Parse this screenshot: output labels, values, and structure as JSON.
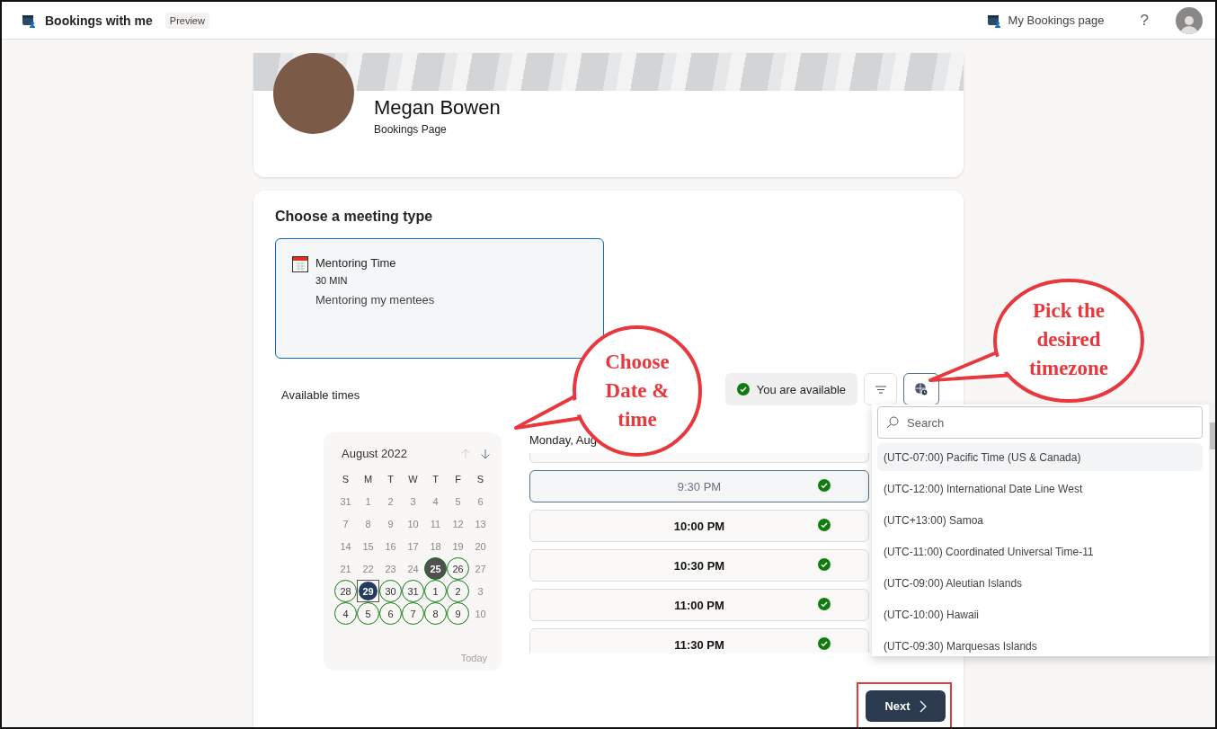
{
  "app": {
    "title": "Bookings with me",
    "badge": "Preview",
    "link": "My Bookings page",
    "help": "?"
  },
  "profile": {
    "name": "Megan Bowen",
    "subtitle": "Bookings Page"
  },
  "meeting_types": {
    "heading": "Choose a meeting type",
    "items": [
      {
        "name": "Mentoring Time",
        "duration": "30 MIN",
        "description": "Mentoring my mentees",
        "selected": true
      }
    ]
  },
  "availability": {
    "heading": "Available times",
    "status": "You are available",
    "available": true
  },
  "calendar": {
    "month": "August 2022",
    "previous_disabled": true,
    "next_disabled": false,
    "weekdays": [
      "S",
      "M",
      "T",
      "W",
      "T",
      "F",
      "S"
    ],
    "today_link": "Today",
    "weeks": [
      [
        {
          "label": "31",
          "available": false,
          "selected": false,
          "today": false
        },
        {
          "label": "1",
          "available": false,
          "selected": false,
          "today": false
        },
        {
          "label": "2",
          "available": false,
          "selected": false,
          "today": false
        },
        {
          "label": "3",
          "available": false,
          "selected": false,
          "today": false
        },
        {
          "label": "4",
          "available": false,
          "selected": false,
          "today": false
        },
        {
          "label": "5",
          "available": false,
          "selected": false,
          "today": false
        },
        {
          "label": "6",
          "available": false,
          "selected": false,
          "today": false
        }
      ],
      [
        {
          "label": "7",
          "available": false,
          "selected": false,
          "today": false
        },
        {
          "label": "8",
          "available": false,
          "selected": false,
          "today": false
        },
        {
          "label": "9",
          "available": false,
          "selected": false,
          "today": false
        },
        {
          "label": "10",
          "available": false,
          "selected": false,
          "today": false
        },
        {
          "label": "11",
          "available": false,
          "selected": false,
          "today": false
        },
        {
          "label": "12",
          "available": false,
          "selected": false,
          "today": false
        },
        {
          "label": "13",
          "available": false,
          "selected": false,
          "today": false
        }
      ],
      [
        {
          "label": "14",
          "available": false,
          "selected": false,
          "today": false
        },
        {
          "label": "15",
          "available": false,
          "selected": false,
          "today": false
        },
        {
          "label": "16",
          "available": false,
          "selected": false,
          "today": false
        },
        {
          "label": "17",
          "available": false,
          "selected": false,
          "today": false
        },
        {
          "label": "18",
          "available": false,
          "selected": false,
          "today": false
        },
        {
          "label": "19",
          "available": false,
          "selected": false,
          "today": false
        },
        {
          "label": "20",
          "available": false,
          "selected": false,
          "today": false
        }
      ],
      [
        {
          "label": "21",
          "available": false,
          "selected": false,
          "today": false
        },
        {
          "label": "22",
          "available": false,
          "selected": false,
          "today": false
        },
        {
          "label": "23",
          "available": false,
          "selected": false,
          "today": false
        },
        {
          "label": "24",
          "available": false,
          "selected": false,
          "today": false
        },
        {
          "label": "25",
          "available": true,
          "selected": false,
          "today": true
        },
        {
          "label": "26",
          "available": true,
          "selected": false,
          "today": false
        },
        {
          "label": "27",
          "available": false,
          "selected": false,
          "today": false
        }
      ],
      [
        {
          "label": "28",
          "available": true,
          "selected": false,
          "today": false
        },
        {
          "label": "29",
          "available": true,
          "selected": true,
          "today": false
        },
        {
          "label": "30",
          "available": true,
          "selected": false,
          "today": false
        },
        {
          "label": "31",
          "available": true,
          "selected": false,
          "today": false
        },
        {
          "label": "1",
          "available": true,
          "selected": false,
          "today": false
        },
        {
          "label": "2",
          "available": true,
          "selected": false,
          "today": false
        },
        {
          "label": "3",
          "available": false,
          "selected": false,
          "today": false
        }
      ],
      [
        {
          "label": "4",
          "available": true,
          "selected": false,
          "today": false
        },
        {
          "label": "5",
          "available": true,
          "selected": false,
          "today": false
        },
        {
          "label": "6",
          "available": true,
          "selected": false,
          "today": false
        },
        {
          "label": "7",
          "available": true,
          "selected": false,
          "today": false
        },
        {
          "label": "8",
          "available": true,
          "selected": false,
          "today": false
        },
        {
          "label": "9",
          "available": true,
          "selected": false,
          "today": false
        },
        {
          "label": "10",
          "available": false,
          "selected": false,
          "today": false
        }
      ]
    ]
  },
  "slots": {
    "date": "Monday, Aug",
    "items": [
      {
        "time": "9:30 PM",
        "selected": true
      },
      {
        "time": "10:00 PM",
        "selected": false
      },
      {
        "time": "10:30 PM",
        "selected": false
      },
      {
        "time": "11:00 PM",
        "selected": false
      },
      {
        "time": "11:30 PM",
        "selected": false
      }
    ]
  },
  "timezone_menu": {
    "placeholder": "Search",
    "items": [
      {
        "label": "(UTC-07:00) Pacific Time (US & Canada)",
        "selected": true
      },
      {
        "label": "(UTC-12:00) International Date Line West",
        "selected": false
      },
      {
        "label": "(UTC+13:00) Samoa",
        "selected": false
      },
      {
        "label": "(UTC-11:00) Coordinated Universal Time-11",
        "selected": false
      },
      {
        "label": "(UTC-09:00) Aleutian Islands",
        "selected": false
      },
      {
        "label": "(UTC-10:00) Hawaii",
        "selected": false
      },
      {
        "label": "(UTC-09:30) Marquesas Islands",
        "selected": false
      }
    ]
  },
  "next_button": "Next",
  "callouts": [
    {
      "text": "Choose Date & time"
    },
    {
      "text": "Pick the desired timezone"
    }
  ]
}
